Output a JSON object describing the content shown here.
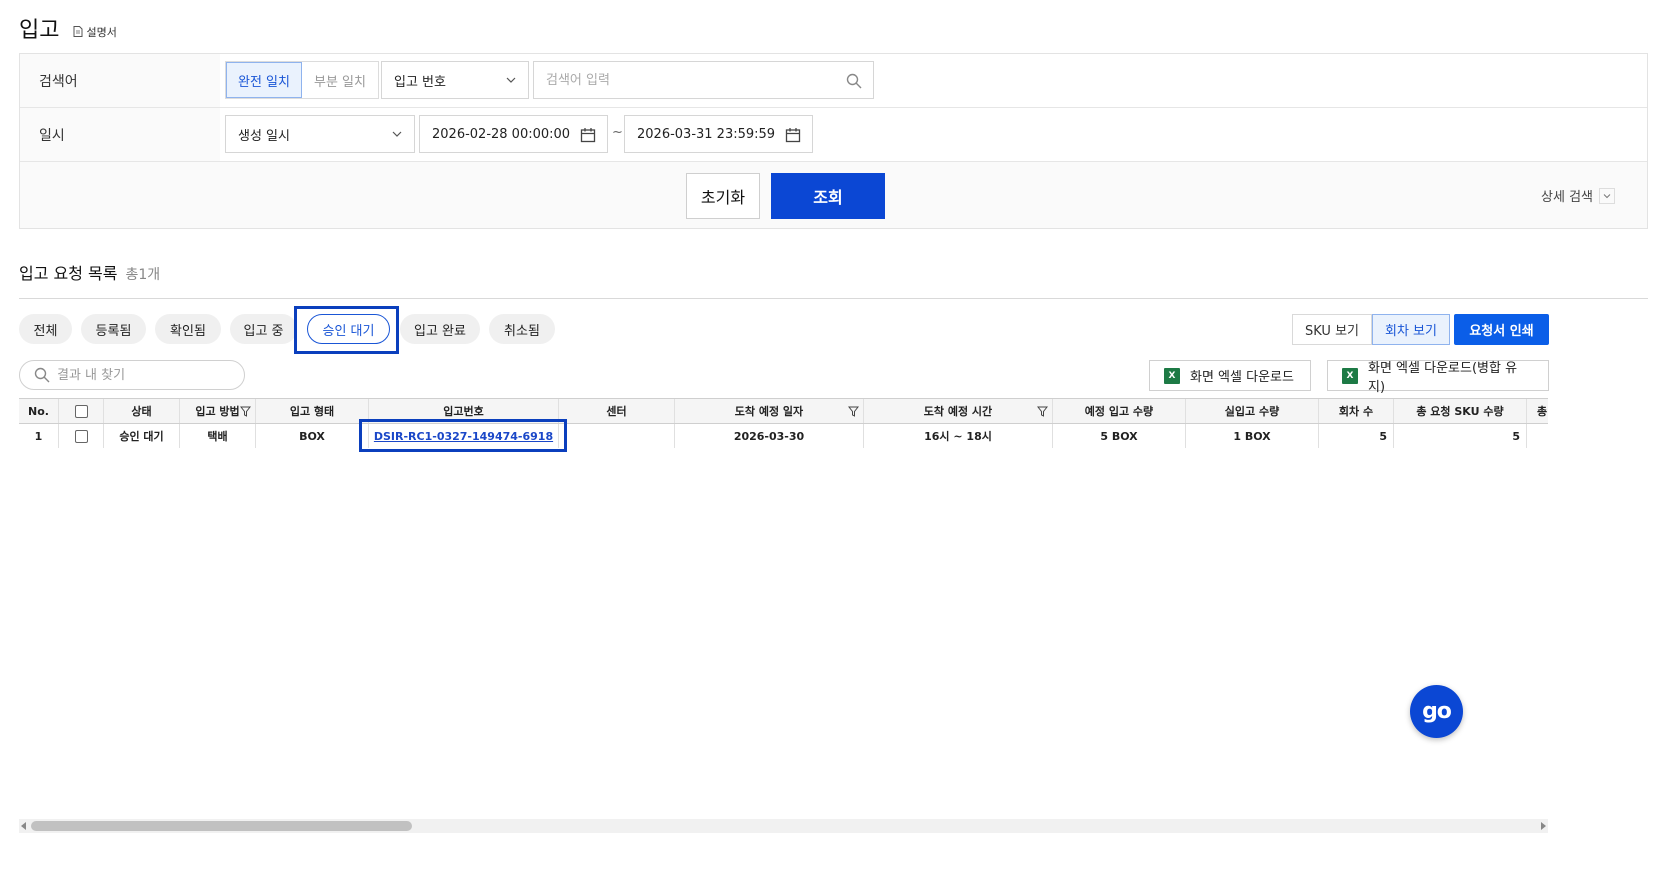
{
  "page": {
    "title": "입고",
    "manual_label": "설명서"
  },
  "search": {
    "keyword_label": "검색어",
    "match_options": [
      "완전 일치",
      "부분 일치"
    ],
    "match_selected": "완전 일치",
    "field_select": "입고 번호",
    "keyword_placeholder": "검색어 입력",
    "datetime_label": "일시",
    "date_type_select": "생성 일시",
    "date_from": "2026-02-28 00:00:00",
    "date_separator": "~",
    "date_to": "2026-03-31 23:59:59",
    "reset_label": "초기화",
    "search_label": "조회",
    "detail_search_label": "상세 검색"
  },
  "list": {
    "title": "입고 요청 목록",
    "count": "총1개",
    "status_tabs": [
      "전체",
      "등록됨",
      "확인됨",
      "입고 중",
      "승인 대기",
      "입고 완료",
      "취소됨"
    ],
    "active_tab": "승인 대기",
    "view_options": [
      "SKU 보기",
      "회차 보기"
    ],
    "view_selected": "회차 보기",
    "print_label": "요청서 인쇄",
    "filter_placeholder": "결과 내 찾기",
    "excel_download_label": "화면 엑셀 다운로드",
    "excel_download_merge_label": "화면 엑셀 다운로드(병합 유지)",
    "excel_icon_text": "X"
  },
  "table": {
    "columns": [
      "No.",
      "",
      "상태",
      "입고 방법",
      "입고 형태",
      "입고번호",
      "센터",
      "도착 예정 일자",
      "도착 예정 시간",
      "예정 입고 수량",
      "실입고 수량",
      "회차 수",
      "총 요청 SKU 수량",
      "총"
    ],
    "rows": [
      {
        "no": "1",
        "status": "승인 대기",
        "method": "택배",
        "type": "BOX",
        "receipt_no": "DSIR-RC1-0327-149474-6918",
        "center": "",
        "arrival_date": "2026-03-30",
        "arrival_time": "16시 ~ 18시",
        "planned_qty": "5 BOX",
        "actual_qty": "1 BOX",
        "round_count": "5",
        "total_sku_qty": "5"
      }
    ]
  },
  "floating": {
    "label": "go"
  },
  "colors": {
    "primary": "#0b47d4",
    "accent_blue": "#1a56d6",
    "highlight": "#0b3fbd",
    "excel_green": "#1d7a45"
  }
}
